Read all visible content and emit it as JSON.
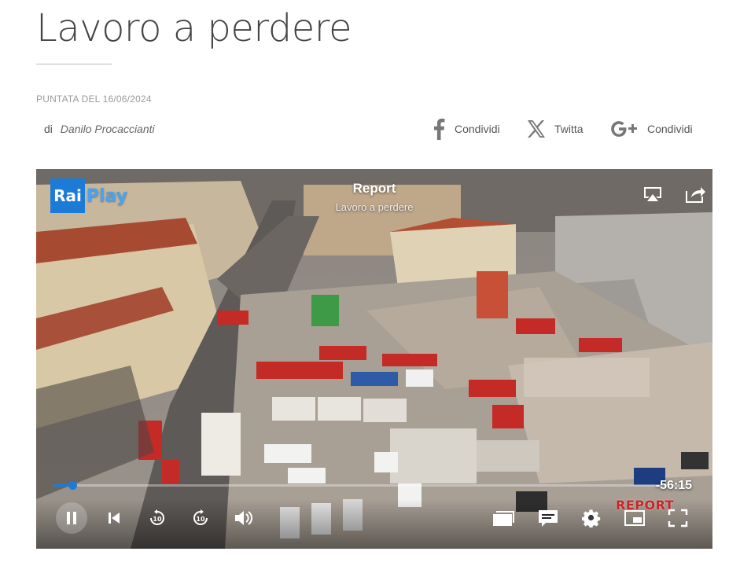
{
  "article": {
    "title": "Lavoro a perdere",
    "date": "PUNTATA DEL 16/06/2024",
    "byline_prefix": "di",
    "author": "Danilo Procaccianti"
  },
  "share": {
    "facebook_label": "Condividi",
    "x_label": "Twitta",
    "google_label": "Condividi",
    "icons": [
      "facebook-icon",
      "x-icon",
      "google-plus-icon"
    ]
  },
  "player": {
    "logo_rai": "Rai",
    "logo_play": "Play",
    "title": "Report",
    "subtitle": "Lavoro a perdere",
    "remaining_time": "-56:15",
    "progress_fraction": 0.03,
    "accent_color": "#1d7bd8",
    "watermark": "REPORT",
    "controls": [
      "pause-icon",
      "skip-previous-icon",
      "rewind-10-icon",
      "forward-10-icon",
      "volume-icon",
      "episodes-icon",
      "subtitles-icon",
      "settings-gear-icon",
      "picture-in-picture-icon",
      "fullscreen-icon"
    ],
    "top_icons": [
      "airplay-icon",
      "share-icon"
    ]
  }
}
